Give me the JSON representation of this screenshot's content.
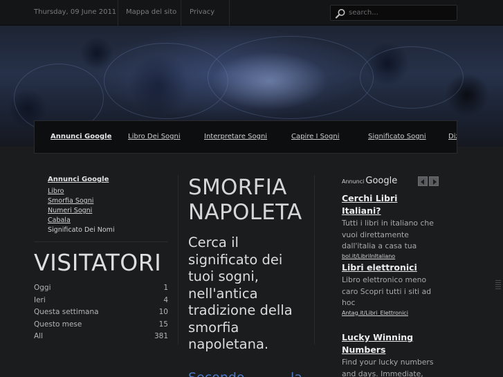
{
  "topbar": {
    "date": "Thursday, 09 June 2011",
    "sitemap": "Mappa del sito",
    "privacy": "Privacy",
    "search_placeholder": "search..."
  },
  "nav": {
    "items": [
      "Annunci Google",
      "Libro Dei Sogni",
      "Interpretare Sogni",
      "Capire I Sogni",
      "Significato Sogni",
      "Diz"
    ]
  },
  "left_ads": {
    "heading": "Annunci Google",
    "links": [
      "Libro",
      "Smorfia Sogni",
      "Numeri Sogni",
      "Cabala",
      "Significato Dei Nomi"
    ]
  },
  "visitors": {
    "title": "VISITATORI",
    "rows": [
      {
        "label": "Oggi",
        "value": "1"
      },
      {
        "label": "Ieri",
        "value": "4"
      },
      {
        "label": "Questa settimana",
        "value": "10"
      },
      {
        "label": "Questo mese",
        "value": "15"
      },
      {
        "label": "All",
        "value": "381"
      }
    ]
  },
  "article": {
    "title_line1": "SMORFIA",
    "title_line2": "NAPOLETANA",
    "lead": "Cerca il significato dei tuoi sogni, nell'antica tradizione della smorfia napoletana.",
    "next_word1": "Secondo",
    "next_word2": "la"
  },
  "right_ads": {
    "brand_prefix": "Annunci",
    "brand_name": "Google",
    "ads": [
      {
        "title": "Cerchi Libri Italiani?",
        "desc": "Tutti i libri in italiano che vuoi direttamente dall'italia a casa tua",
        "url": "bol.it/LibriInItaliano"
      },
      {
        "title": "Libri elettronici",
        "desc": "Libro elettronico meno caro Scopri tutti i siti ad hoc",
        "url": "Antag.it/Libri_Elettronici"
      },
      {
        "title": "Lucky Winning Numbers",
        "desc": "Find your lucky numbers and days. Immediate,",
        "url": ""
      }
    ]
  },
  "colors": {
    "background": "#1b1c1e",
    "link_blue": "#4a78c0",
    "banner_blue": "#263149"
  }
}
